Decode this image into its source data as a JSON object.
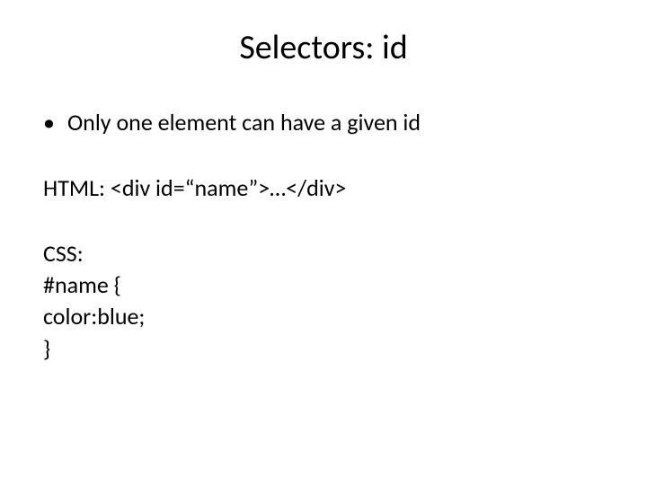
{
  "slide": {
    "title": "Selectors: id",
    "bullet": "Only one element can have a given id",
    "html_label": "HTML: <div id=“name”>…</div>",
    "css_label": "CSS:",
    "css_line1": "#name {",
    "css_line2": "color:blue;",
    "css_line3": "}"
  }
}
